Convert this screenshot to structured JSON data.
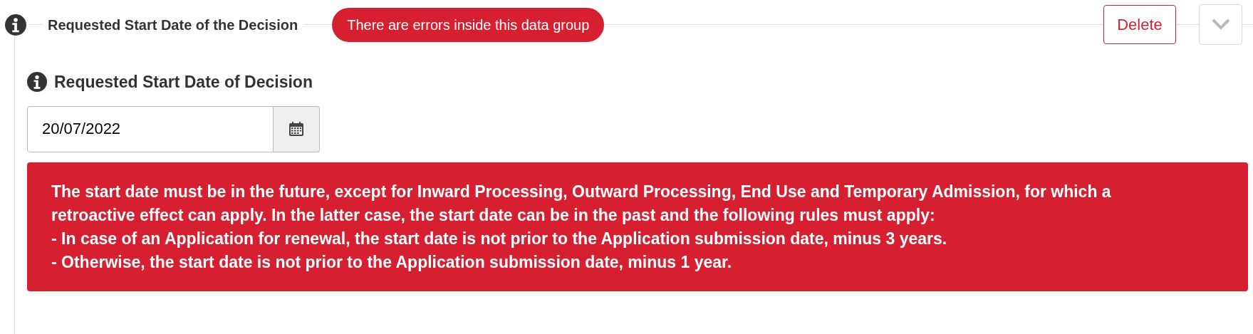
{
  "group": {
    "title": "Requested Start Date of the Decision",
    "error_badge": "There are errors inside this data group",
    "delete_button": "Delete",
    "expanded": true
  },
  "field": {
    "label": "Requested Start Date of Decision",
    "value": "20/07/2022"
  },
  "error": {
    "lines": [
      "The start date must be in the future, except for Inward Processing, Outward Processing, End Use and Temporary Admission, for which a retroactive effect can apply. In the latter case, the start date can be in the past and the following rules must apply:",
      "- In case of an Application for renewal, the start date is not prior to the Application submission date, minus 3 years.",
      "- Otherwise, the start date is not prior to the Application submission date, minus 1 year."
    ]
  }
}
